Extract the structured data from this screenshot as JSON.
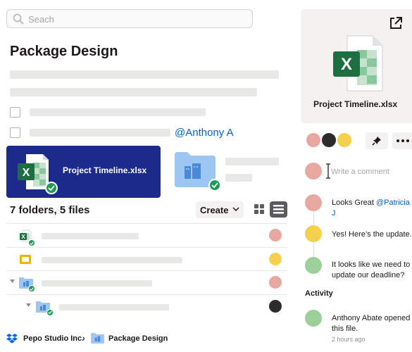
{
  "search": {
    "placeholder": "Seach"
  },
  "page": {
    "title": "Package Design"
  },
  "mention": "@Anthony A",
  "selected_file": {
    "name": "Project Timeline.xlsx"
  },
  "summary": {
    "text": "7 folders, 5 files"
  },
  "toolbar": {
    "create_label": "Create"
  },
  "breadcrumb": {
    "root": "Pepo Studio Inc.",
    "current": "Package Design"
  },
  "preview": {
    "file_name": "Project Timeline.xlsx"
  },
  "comments": {
    "input_placeholder": "Write a comment",
    "items": [
      {
        "text": "Looks Great ",
        "mention": "@Patricia J"
      },
      {
        "text": "Yes! Here’s the update."
      },
      {
        "text": "It looks like we need to update our deadline?"
      }
    ]
  },
  "activity": {
    "heading": "Activity",
    "event": "Anthony Abate opened this file.",
    "time": "2 hours ago"
  },
  "colors": {
    "accent_blue": "#0061d3",
    "selected_card": "#1b2a8b",
    "sync_green": "#1e9a55",
    "excel_green": "#1d6f42"
  }
}
